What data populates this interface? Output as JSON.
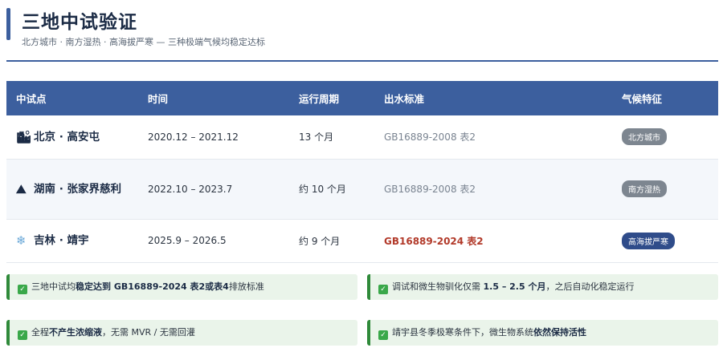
{
  "header": {
    "title": "三地中试验证",
    "subtitle": "北方城市 · 南方湿热 · 高海拔严寒 — 三种极端气候均稳定达标"
  },
  "table": {
    "columns": [
      "中试点",
      "时间",
      "运行周期",
      "出水标准",
      "气候特征"
    ],
    "rows": [
      {
        "icon": "city-building-icon",
        "site": "北京 · 高安屯",
        "time": "2020.12 – 2021.12",
        "period": "13 个月",
        "standard": "GB16889-2008 表2",
        "standard_highlight": false,
        "climate": "北方城市",
        "climate_color": "#7d8690"
      },
      {
        "icon": "mountain-icon",
        "site": "湖南 · 张家界慈利",
        "time": "2022.10 – 2023.7",
        "period": "约 10 个月",
        "standard": "GB16889-2008 表2",
        "standard_highlight": false,
        "climate": "南方湿热",
        "climate_color": "#7d8690"
      },
      {
        "icon": "snowflake-icon",
        "site": "吉林 · 靖宇",
        "time": "2025.9 – 2026.5",
        "period": "约 9 个月",
        "standard": "GB16889-2024 表2",
        "standard_highlight": true,
        "climate": "高海拔严寒",
        "climate_color": "#2f4c8a"
      }
    ]
  },
  "notes": [
    {
      "pre": "三地中试均",
      "bold": "稳定达到 GB16889-2024 表2或表4",
      "post": "排放标准"
    },
    {
      "pre": "调试和微生物驯化仅需 ",
      "bold": "1.5 – 2.5 个月",
      "post": "，之后自动化稳定运行"
    },
    {
      "pre": "全程",
      "bold": "不产生浓缩液",
      "post": "，无需 MVR / 无需回灌"
    },
    {
      "pre": "靖宇县冬季极寒条件下，微生物系统",
      "bold": "依然保持活性",
      "post": ""
    }
  ],
  "colors": {
    "accent": "#3c5f9e",
    "note_border": "#2f8a3a",
    "highlight": "#b23a2a"
  }
}
